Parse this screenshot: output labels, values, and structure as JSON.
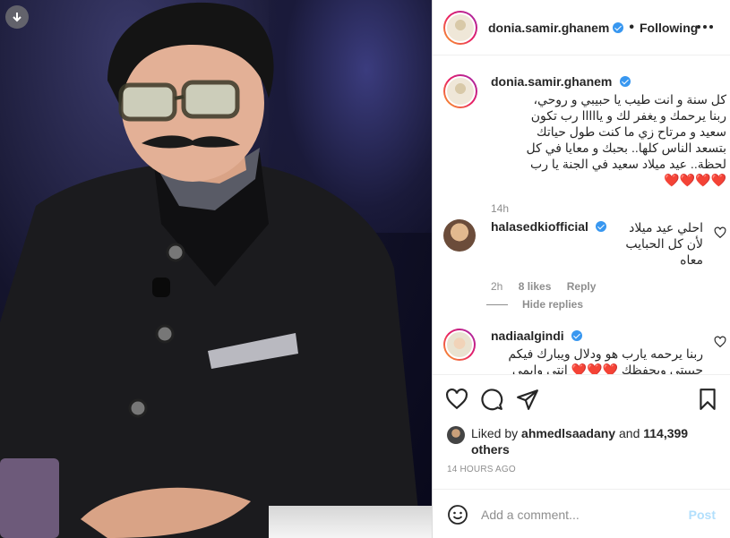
{
  "post": {
    "username": "donia.samir.ghanem",
    "follow_status": "Following",
    "separator": "•",
    "more_icon": "more-horizontal-icon"
  },
  "caption": {
    "username": "donia.samir.ghanem",
    "text": "كل سنة و انت طيب يا حبيبي و روحي، ربنا يرحمك و يغفر لك و يااااا رب تكون سعيد و مرتاح زي ما كنت طول حياتك بتسعد الناس كلها.. بحبك و معايا في كل لحظة.. عيد ميلاد سعيد في الجنة يا رب ❤️❤️❤️❤️",
    "time": "14h"
  },
  "comments": [
    {
      "username": "halasedkiofficial",
      "verified": true,
      "text": "احلي عيد ميلاد لأن كل الحبايب معاه",
      "time": "2h",
      "likes": "8 likes",
      "reply_label": "Reply"
    },
    {
      "username": "nadiaalgindi",
      "verified": true,
      "text": "ربنا يرحمه يارب هو ودلال ويبارك فيكم حبيبتي ويحفظك ❤️❤️❤️ انتي وايمي"
    }
  ],
  "hide_replies_label": "Hide replies",
  "likes": {
    "prefix": "Liked by",
    "user": "ahmedlsaadany",
    "middle": "and",
    "others": "114,399 others"
  },
  "timestamp": "14 HOURS AGO",
  "add_comment": {
    "placeholder": "Add a comment...",
    "post_label": "Post"
  },
  "colors": {
    "verified": "#3897f0",
    "post_disabled": "#b2dffc",
    "heart": "#ed4956"
  }
}
